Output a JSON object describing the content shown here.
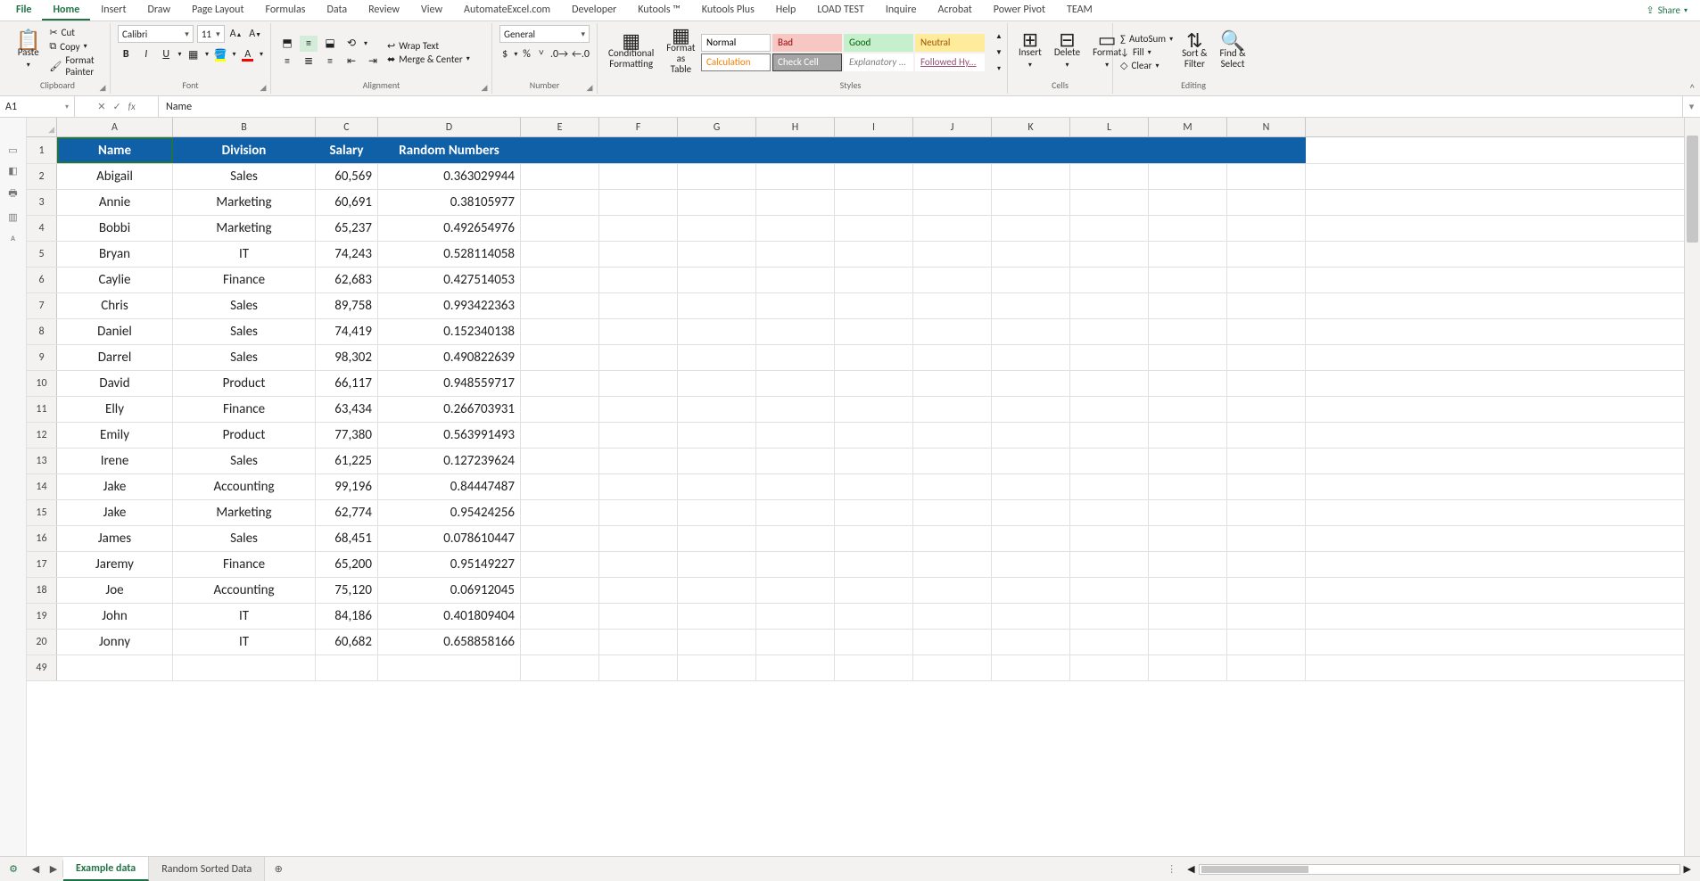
{
  "tabs": [
    "File",
    "Home",
    "Insert",
    "Draw",
    "Page Layout",
    "Formulas",
    "Data",
    "Review",
    "View",
    "AutomateExcel.com",
    "Developer",
    "Kutools ™",
    "Kutools Plus",
    "Help",
    "LOAD TEST",
    "Inquire",
    "Acrobat",
    "Power Pivot",
    "TEAM"
  ],
  "active_tab": 1,
  "share_label": "Share",
  "clipboard": {
    "cut": "Cut",
    "copy": "Copy",
    "fp": "Format Painter",
    "paste": "Paste",
    "group": "Clipboard"
  },
  "font": {
    "name": "Calibri",
    "size": "11",
    "bold": "B",
    "italic": "I",
    "underline": "U",
    "group": "Font"
  },
  "alignment": {
    "wrap": "Wrap Text",
    "merge": "Merge & Center",
    "group": "Alignment"
  },
  "number": {
    "sel": "General",
    "group": "Number"
  },
  "cond": {
    "cf": "Conditional\nFormatting",
    "ft": "Format as\nTable"
  },
  "styles": {
    "group": "Styles",
    "items": [
      {
        "label": "Normal",
        "bg": "#ffffff",
        "color": "#000",
        "border": "#c6c6c6"
      },
      {
        "label": "Bad",
        "bg": "#f7c7c3",
        "color": "#9c0006",
        "border": "#f7c7c3"
      },
      {
        "label": "Good",
        "bg": "#c6efce",
        "color": "#006100",
        "border": "#c6efce"
      },
      {
        "label": "Neutral",
        "bg": "#ffeb9c",
        "color": "#9c5700",
        "border": "#ffeb9c"
      },
      {
        "label": "Calculation",
        "bg": "#fff",
        "color": "#fa7d00",
        "border": "#7f7f7f"
      },
      {
        "label": "Check Cell",
        "bg": "#a5a5a5",
        "color": "#fff",
        "border": "#3f3f3f"
      },
      {
        "label": "Explanatory ...",
        "bg": "#fff",
        "color": "#7f7f7f",
        "border": "#fff",
        "italic": true
      },
      {
        "label": "Followed Hy...",
        "bg": "#fff",
        "color": "#954f72",
        "border": "#fff",
        "underline": true
      }
    ]
  },
  "cells": {
    "insert": "Insert",
    "delete": "Delete",
    "format": "Format",
    "group": "Cells"
  },
  "editing": {
    "autosum": "AutoSum",
    "fill": "Fill",
    "clear": "Clear",
    "sort": "Sort &\nFilter",
    "find": "Find &\nSelect",
    "group": "Editing"
  },
  "namebox": "A1",
  "formula": "Name",
  "columns": [
    "A",
    "B",
    "C",
    "D",
    "E",
    "F",
    "G",
    "H",
    "I",
    "J",
    "K",
    "L",
    "M",
    "N"
  ],
  "row_heads": [
    1,
    2,
    3,
    4,
    5,
    6,
    7,
    8,
    9,
    10,
    11,
    12,
    13,
    14,
    15,
    16,
    17,
    18,
    19,
    20,
    49
  ],
  "header_row": [
    "Name",
    "Division",
    "Salary",
    "Random Numbers"
  ],
  "data_rows": [
    [
      "Abigail",
      "Sales",
      "60,569",
      "0.363029944"
    ],
    [
      "Annie",
      "Marketing",
      "60,691",
      "0.38105977"
    ],
    [
      "Bobbi",
      "Marketing",
      "65,237",
      "0.492654976"
    ],
    [
      "Bryan",
      "IT",
      "74,243",
      "0.528114058"
    ],
    [
      "Caylie",
      "Finance",
      "62,683",
      "0.427514053"
    ],
    [
      "Chris",
      "Sales",
      "89,758",
      "0.993422363"
    ],
    [
      "Daniel",
      "Sales",
      "74,419",
      "0.152340138"
    ],
    [
      "Darrel",
      "Sales",
      "98,302",
      "0.490822639"
    ],
    [
      "David",
      "Product",
      "66,117",
      "0.948559717"
    ],
    [
      "Elly",
      "Finance",
      "63,434",
      "0.266703931"
    ],
    [
      "Emily",
      "Product",
      "77,380",
      "0.563991493"
    ],
    [
      "Irene",
      "Sales",
      "61,225",
      "0.127239624"
    ],
    [
      "Jake",
      "Accounting",
      "99,196",
      "0.84447487"
    ],
    [
      "Jake",
      "Marketing",
      "62,774",
      "0.95424256"
    ],
    [
      "James",
      "Sales",
      "68,451",
      "0.078610447"
    ],
    [
      "Jaremy",
      "Finance",
      "65,200",
      "0.95149227"
    ],
    [
      "Joe",
      "Accounting",
      "75,120",
      "0.06912045"
    ],
    [
      "John",
      "IT",
      "84,186",
      "0.401809404"
    ],
    [
      "Jonny",
      "IT",
      "60,682",
      "0.658858166"
    ]
  ],
  "sheets": [
    "Example data",
    "Random Sorted Data"
  ],
  "active_sheet": 0
}
